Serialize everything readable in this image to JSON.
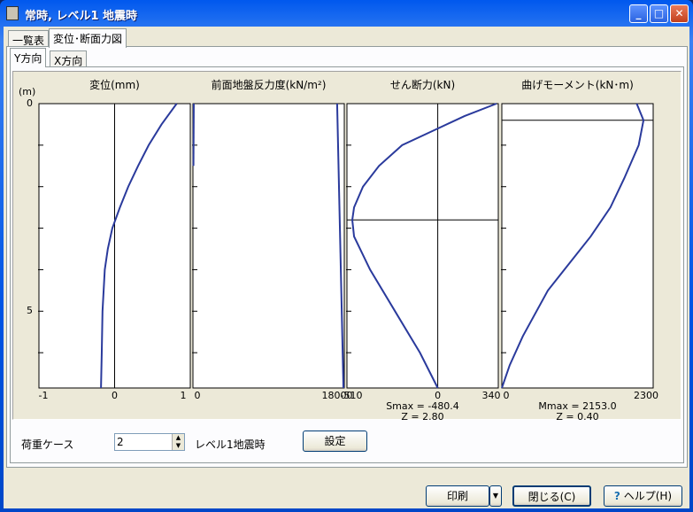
{
  "window": {
    "title": "常時, レベル1 地震時",
    "minimize": "_",
    "maximize": "□",
    "close": "✕"
  },
  "tabs": [
    {
      "label": "一覧表"
    },
    {
      "label": "変位･断面力図"
    }
  ],
  "subtabs": [
    {
      "label": "Y方向"
    },
    {
      "label": "X方向"
    }
  ],
  "depth_unit": "(m)",
  "depth_ticks": [
    "0",
    "5"
  ],
  "chart_data": [
    {
      "type": "line",
      "title": "変位(mm)",
      "xlim": [
        -1,
        1
      ],
      "xticks": [
        "-1",
        "0",
        "1"
      ],
      "ylim": [
        0,
        6.85
      ],
      "ylabel": "(m)",
      "series": [
        {
          "name": "disp",
          "points": [
            [
              0,
              0.82
            ],
            [
              0.5,
              0.62
            ],
            [
              1,
              0.45
            ],
            [
              1.5,
              0.31
            ],
            [
              2,
              0.18
            ],
            [
              2.5,
              0.07
            ],
            [
              3,
              -0.03
            ],
            [
              3.5,
              -0.09
            ],
            [
              4,
              -0.13
            ],
            [
              5,
              -0.16
            ],
            [
              6,
              -0.17
            ],
            [
              6.85,
              -0.18
            ]
          ]
        }
      ]
    },
    {
      "type": "line",
      "title": "前面地盤反力度(kN/m²)",
      "xlim": [
        0,
        18000
      ],
      "xticks": [
        "0",
        "18000"
      ],
      "ylim": [
        0,
        6.85
      ],
      "series": [
        {
          "name": "limit",
          "points": [
            [
              0,
              17150
            ],
            [
              6.85,
              17900
            ]
          ]
        },
        {
          "name": "reaction",
          "points": [
            [
              0,
              100
            ],
            [
              1.5,
              60
            ]
          ]
        }
      ]
    },
    {
      "type": "line",
      "title": "せん断力(kN)",
      "xlim": [
        -510,
        340
      ],
      "xticks": [
        "-510",
        "0",
        "340"
      ],
      "ylim": [
        0,
        6.85
      ],
      "marker_depth": 2.8,
      "annotation": [
        "Smax = -480.4",
        "Z = 2.80"
      ],
      "series": [
        {
          "name": "shear",
          "points": [
            [
              0,
              330
            ],
            [
              0.3,
              150
            ],
            [
              0.6,
              0
            ],
            [
              1,
              -200
            ],
            [
              1.5,
              -330
            ],
            [
              2,
              -420
            ],
            [
              2.5,
              -470
            ],
            [
              2.8,
              -480
            ],
            [
              3.2,
              -470
            ],
            [
              4,
              -380
            ],
            [
              5,
              -240
            ],
            [
              6,
              -100
            ],
            [
              6.85,
              0
            ]
          ]
        }
      ]
    },
    {
      "type": "line",
      "title": "曲げモーメント(kN･m)",
      "xlim": [
        0,
        2300
      ],
      "xticks": [
        "0",
        "2300"
      ],
      "ylim": [
        0,
        6.85
      ],
      "marker_depth": 0.4,
      "annotation": [
        "Mmax = 2153.0",
        "Z = 0.40"
      ],
      "series": [
        {
          "name": "moment",
          "points": [
            [
              0,
              2050
            ],
            [
              0.4,
              2153
            ],
            [
              1,
              2080
            ],
            [
              1.8,
              1860
            ],
            [
              2.5,
              1650
            ],
            [
              3.2,
              1350
            ],
            [
              3.9,
              1000
            ],
            [
              4.5,
              700
            ],
            [
              5.6,
              320
            ],
            [
              6.3,
              120
            ],
            [
              6.85,
              0
            ]
          ]
        }
      ]
    }
  ],
  "load_case": {
    "label": "荷重ケース",
    "value": "2",
    "name": "レベル1地震時",
    "set_button": "設定"
  },
  "footer": {
    "print": "印刷",
    "close": "閉じる(C)",
    "help": "ヘルプ(H)"
  },
  "colors": {
    "curve": "#2a3a9c"
  }
}
